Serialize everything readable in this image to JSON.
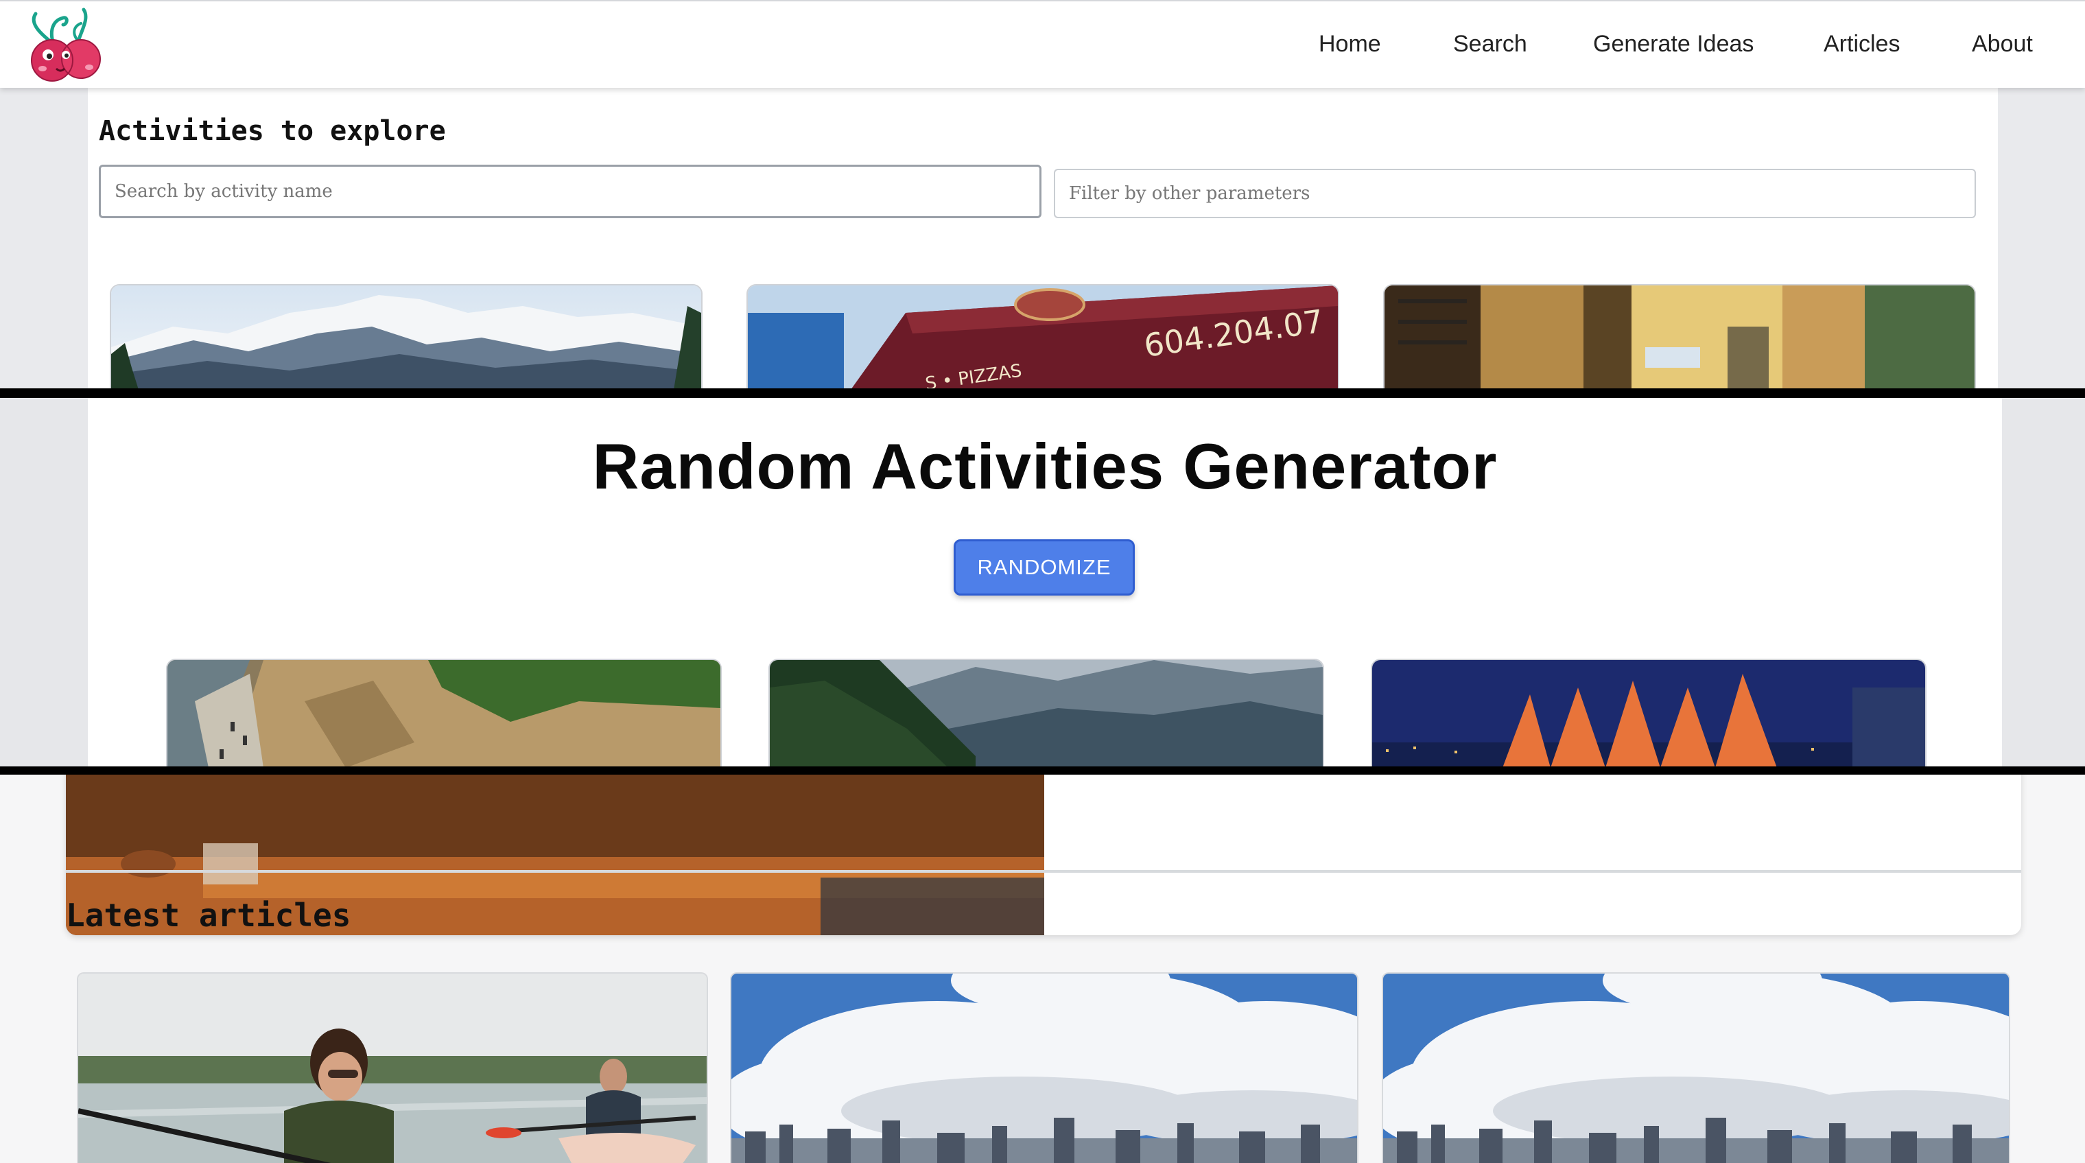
{
  "nav": {
    "logo_icon": "cherries-logo-icon",
    "links": [
      "Home",
      "Search",
      "Generate Ideas",
      "Articles",
      "About"
    ]
  },
  "explore": {
    "title": "Activities to explore",
    "search_placeholder": "Search by activity name",
    "filter_placeholder": "Filter by other parameters"
  },
  "generator": {
    "title": "Random Activities Generator",
    "button_label": "RANDOMIZE"
  },
  "articles": {
    "title": "Latest articles"
  },
  "colors": {
    "accent": "#4e7fe9",
    "divider": "#000000"
  }
}
